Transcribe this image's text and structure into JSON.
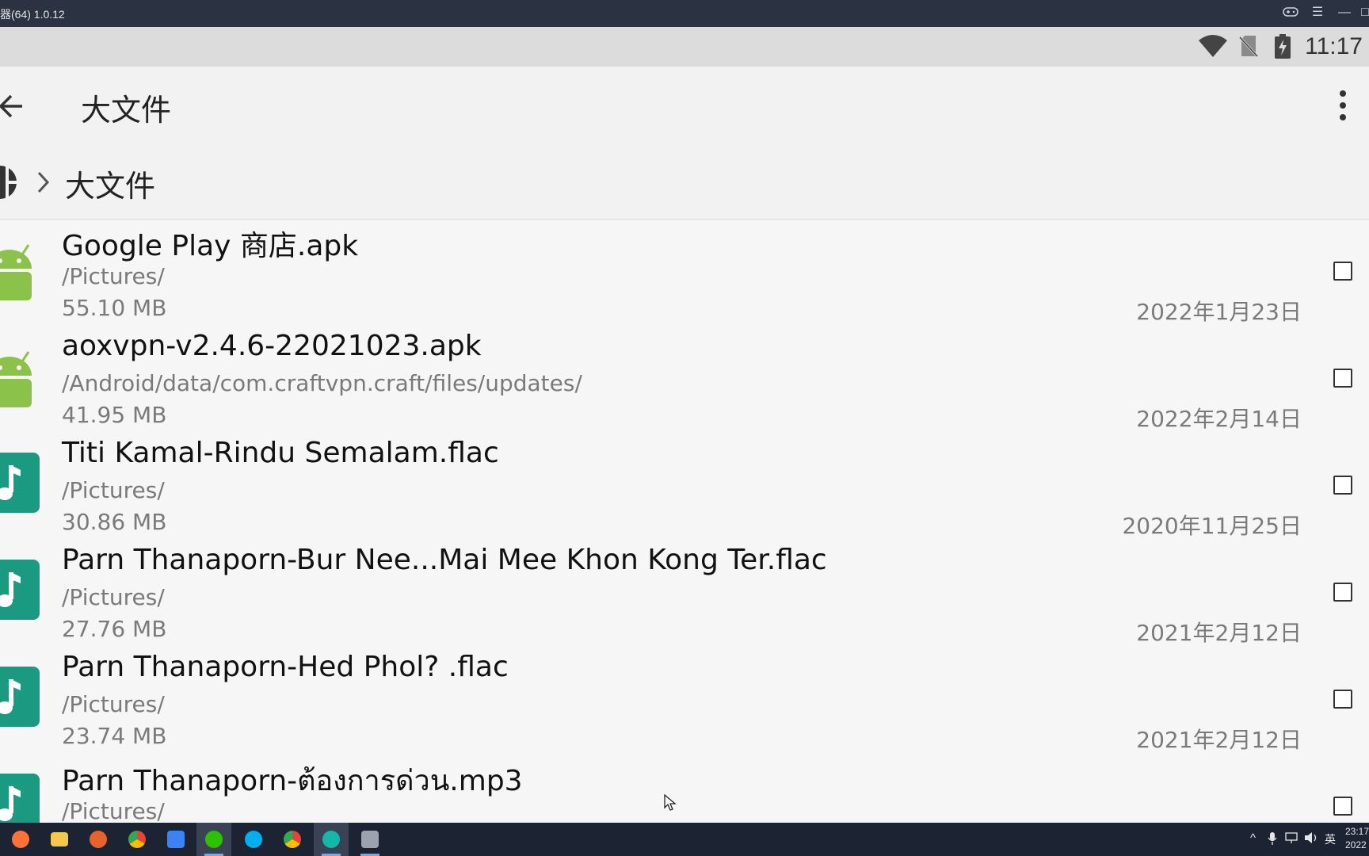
{
  "window": {
    "title": "器(64) 1.0.12",
    "controls": [
      "gamepad-icon",
      "menu-icon",
      "minimize-icon",
      "restore-icon"
    ]
  },
  "statusbar": {
    "time": "11:17",
    "icons": [
      "wifi-icon",
      "no-sim-icon",
      "battery-charging-icon"
    ]
  },
  "appbar": {
    "title": "大文件",
    "back_icon": "back-arrow-icon",
    "menu_icon": "more-vert-icon"
  },
  "breadcrumb": {
    "root_icon": "storage-icon",
    "separator_icon": "chevron-right-icon",
    "current": "大文件"
  },
  "files": [
    {
      "icon": "android-apk-icon",
      "name": "Google Play 商店.apk",
      "path": "/Pictures/",
      "size": "55.10 MB",
      "date": "2022年1月23日",
      "checked": false
    },
    {
      "icon": "android-apk-icon",
      "name": "aoxvpn-v2.4.6-22021023.apk",
      "path": "/Android/data/com.craftvpn.craft/files/updates/",
      "size": "41.95 MB",
      "date": "2022年2月14日",
      "checked": false
    },
    {
      "icon": "music-note-icon",
      "name": "Titi Kamal-Rindu Semalam.flac",
      "path": "/Pictures/",
      "size": "30.86 MB",
      "date": "2020年11月25日",
      "checked": false
    },
    {
      "icon": "music-note-icon",
      "name": "Parn Thanaporn-Bur Nee...Mai Mee Khon Kong Ter.flac",
      "path": "/Pictures/",
      "size": "27.76 MB",
      "date": "2021年2月12日",
      "checked": false
    },
    {
      "icon": "music-note-icon",
      "name": "Parn Thanaporn-Hed Phol?  .flac",
      "path": "/Pictures/",
      "size": "23.74 MB",
      "date": "2021年2月12日",
      "checked": false
    },
    {
      "icon": "music-note-icon",
      "name": "Parn Thanaporn-ต้องการด่วน.mp3",
      "path": "/Pictures/",
      "size": "",
      "date": "",
      "checked": false
    }
  ],
  "taskbar": {
    "apps": [
      {
        "name": "firefox-icon",
        "color": "#ff7139"
      },
      {
        "name": "file-explorer-icon",
        "color": "#f2c94c"
      },
      {
        "name": "browser-icon",
        "color": "#e8632b"
      },
      {
        "name": "chrome-icon",
        "color": "#34a853"
      },
      {
        "name": "mail-icon",
        "color": "#3b82f6"
      },
      {
        "name": "wechat-icon",
        "color": "#2dc100"
      },
      {
        "name": "skype-icon",
        "color": "#00aff0"
      },
      {
        "name": "chrome-icon",
        "color": "#ea4335"
      },
      {
        "name": "emulator-icon",
        "color": "#14b8a6"
      },
      {
        "name": "notepad-icon",
        "color": "#9ca3af"
      }
    ],
    "tray": {
      "ime": "英"
    },
    "clock": {
      "time": "23:17",
      "date": "2022"
    }
  }
}
